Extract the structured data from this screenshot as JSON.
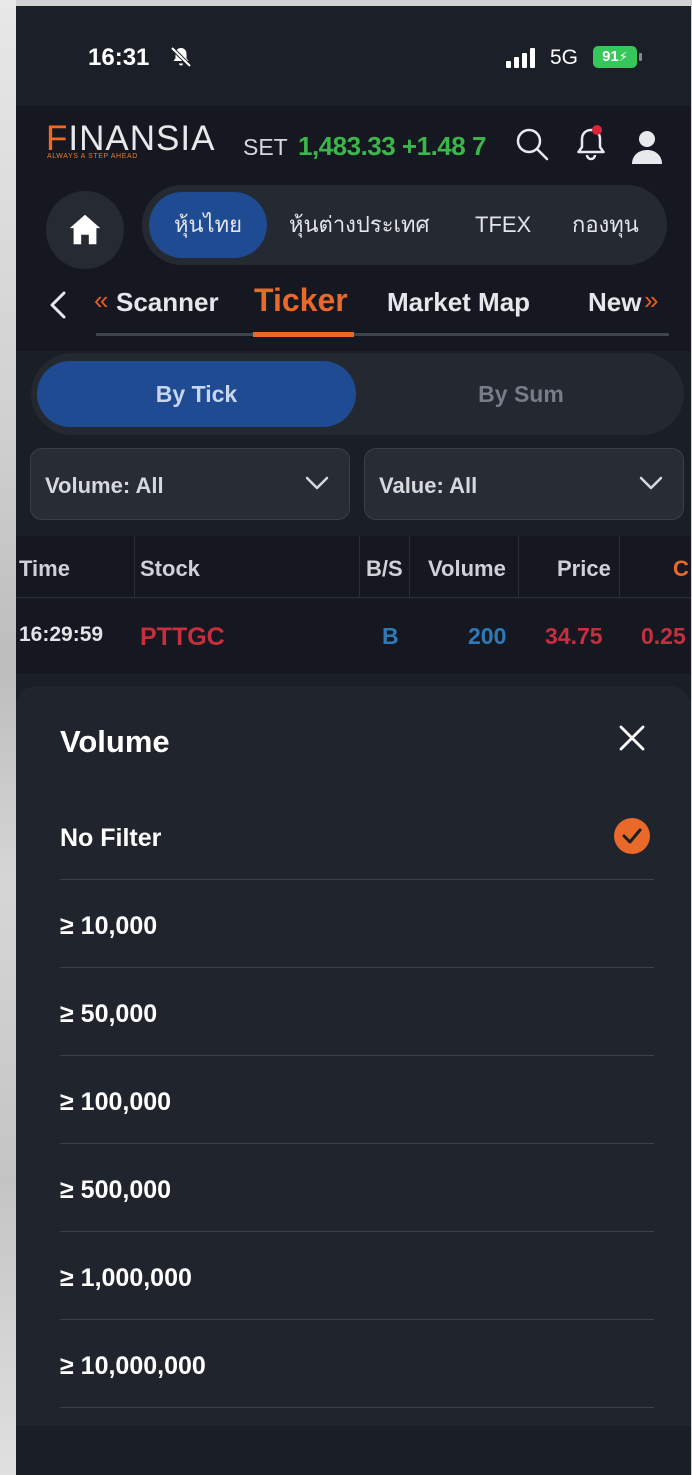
{
  "status_bar": {
    "time": "16:31",
    "network": "5G",
    "battery": "91"
  },
  "header": {
    "logo": "FINANSIA",
    "logo_tagline": "ALWAYS A STEP AHEAD",
    "index_label": "SET",
    "index_value": "1,483.33 +1.48 7"
  },
  "category_tabs": [
    "หุ้นไทย",
    "หุ้นต่างประเทศ",
    "TFEX",
    "กองทุน"
  ],
  "sub_tabs": [
    "Scanner",
    "Ticker",
    "Market Map",
    "New"
  ],
  "mode_toggle": {
    "by_tick": "By Tick",
    "by_sum": "By Sum",
    "selected": "By Tick"
  },
  "filters": {
    "volume": "Volume: All",
    "value": "Value: All"
  },
  "table": {
    "columns": [
      "Time",
      "Stock",
      "B/S",
      "Volume",
      "Price",
      "C"
    ],
    "rows": [
      {
        "time": "16:29:59",
        "stock": "PTTGC",
        "side": "B",
        "volume": "200",
        "price": "34.75",
        "change": "0.25"
      }
    ]
  },
  "volume_sheet": {
    "title": "Volume",
    "options": [
      "No Filter",
      "≥ 10,000",
      "≥ 50,000",
      "≥ 100,000",
      "≥ 500,000",
      "≥ 1,000,000",
      "≥ 10,000,000"
    ],
    "selected": "No Filter"
  },
  "colors": {
    "accent": "#e8692a",
    "selected_blue": "#1f4b93",
    "positive": "#3cb54a",
    "buy_blue": "#2f79b8",
    "stock_red": "#c62f3f"
  },
  "icons": [
    "mute-icon",
    "signal-icon",
    "search-icon",
    "bell-icon",
    "user-icon",
    "home-icon",
    "back-icon",
    "chevron-down-icon",
    "close-icon",
    "check-icon"
  ]
}
